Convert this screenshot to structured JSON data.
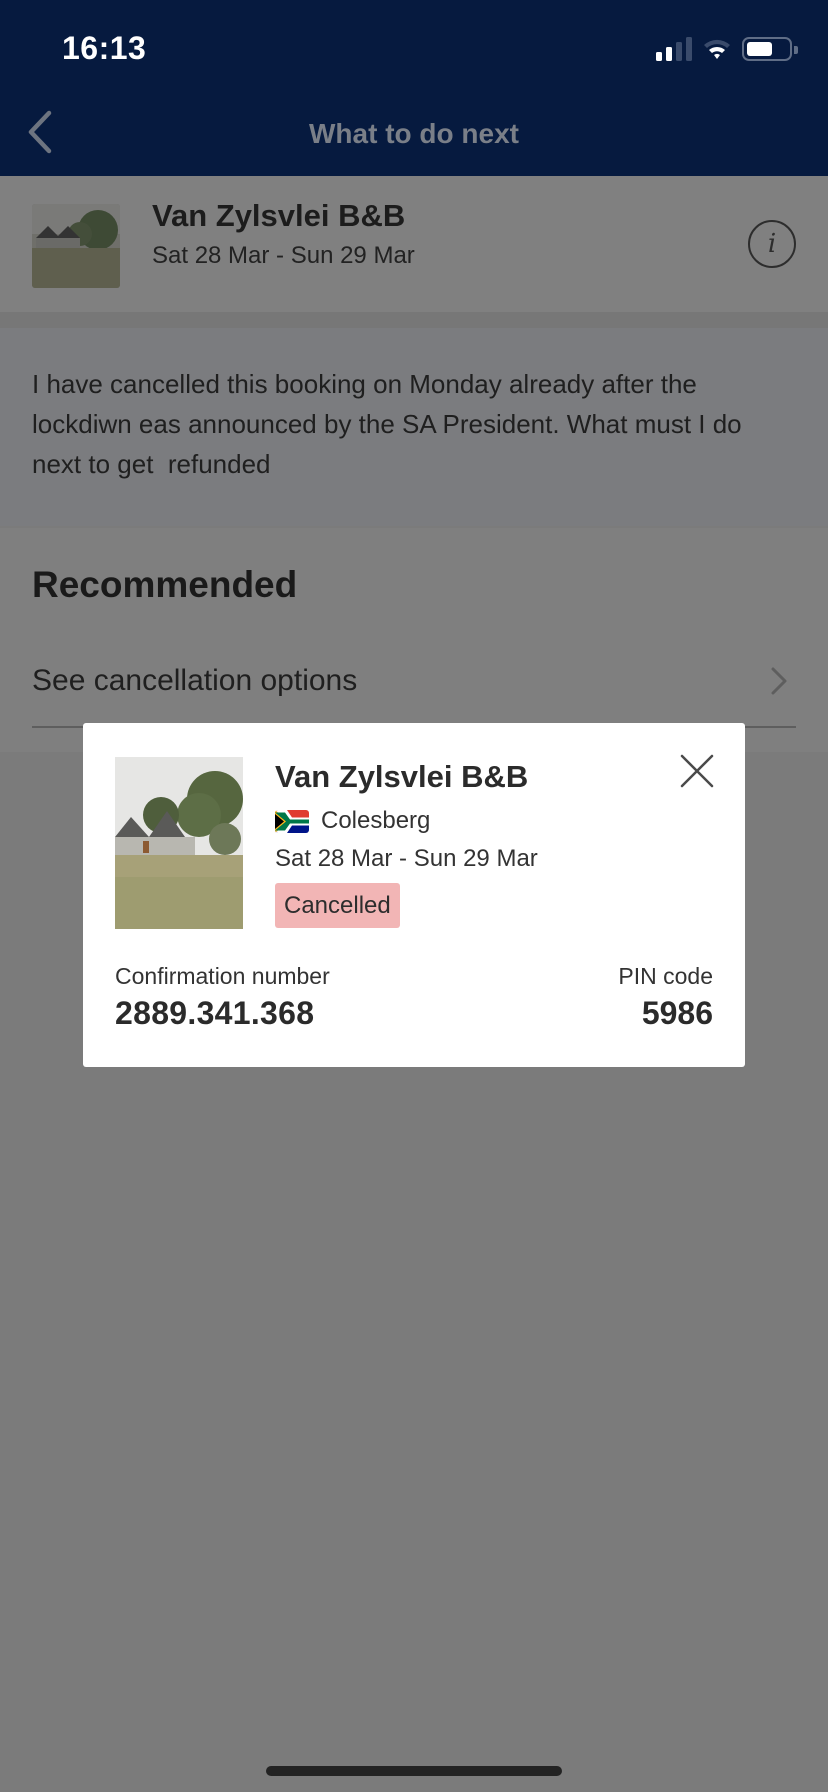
{
  "status_bar": {
    "time": "16:13",
    "icons": [
      "signal-icon",
      "wifi-icon",
      "battery-icon"
    ]
  },
  "nav": {
    "back_icon": "chevron-left-icon",
    "title": "What to do next"
  },
  "booking": {
    "name": "Van Zylsvlei B&B",
    "dates": "Sat 28 Mar - Sun 29 Mar",
    "info_icon": "info-icon"
  },
  "message": {
    "text": "I have cancelled this booking on Monday already after the lockdiwn eas announced by the SA President. What must I do next to get  refunded"
  },
  "recommended": {
    "title": "Recommended",
    "items": [
      {
        "label": "See cancellation options",
        "icon": "chevron-right-icon"
      }
    ]
  },
  "popup": {
    "name": "Van Zylsvlei B&B",
    "country_flag": "south-africa-flag-icon",
    "city": "Colesberg",
    "dates": "Sat 28 Mar - Sun 29 Mar",
    "status": "Cancelled",
    "confirmation_label": "Confirmation number",
    "confirmation_value": "2889.341.368",
    "pin_label": "PIN code",
    "pin_value": "5986",
    "close_icon": "close-icon"
  },
  "colors": {
    "nav_bg": "#061a3f",
    "overlay_bg": "#7b7b7b",
    "badge_bg": "#f2b5b5",
    "card_bg": "#ffffff"
  }
}
